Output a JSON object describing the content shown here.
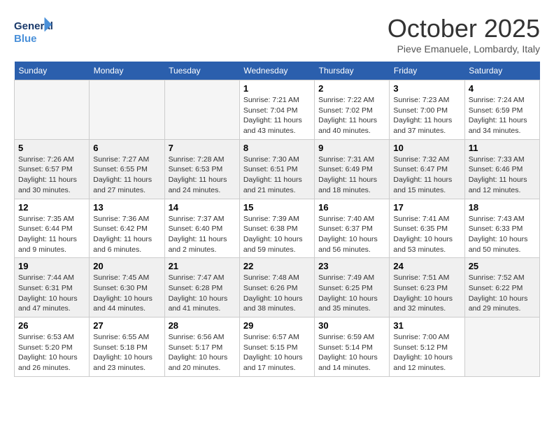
{
  "header": {
    "logo_line1": "General",
    "logo_line2": "Blue",
    "month": "October 2025",
    "location": "Pieve Emanuele, Lombardy, Italy"
  },
  "days_of_week": [
    "Sunday",
    "Monday",
    "Tuesday",
    "Wednesday",
    "Thursday",
    "Friday",
    "Saturday"
  ],
  "weeks": [
    [
      {
        "day": "",
        "info": ""
      },
      {
        "day": "",
        "info": ""
      },
      {
        "day": "",
        "info": ""
      },
      {
        "day": "1",
        "info": "Sunrise: 7:21 AM\nSunset: 7:04 PM\nDaylight: 11 hours\nand 43 minutes."
      },
      {
        "day": "2",
        "info": "Sunrise: 7:22 AM\nSunset: 7:02 PM\nDaylight: 11 hours\nand 40 minutes."
      },
      {
        "day": "3",
        "info": "Sunrise: 7:23 AM\nSunset: 7:00 PM\nDaylight: 11 hours\nand 37 minutes."
      },
      {
        "day": "4",
        "info": "Sunrise: 7:24 AM\nSunset: 6:59 PM\nDaylight: 11 hours\nand 34 minutes."
      }
    ],
    [
      {
        "day": "5",
        "info": "Sunrise: 7:26 AM\nSunset: 6:57 PM\nDaylight: 11 hours\nand 30 minutes."
      },
      {
        "day": "6",
        "info": "Sunrise: 7:27 AM\nSunset: 6:55 PM\nDaylight: 11 hours\nand 27 minutes."
      },
      {
        "day": "7",
        "info": "Sunrise: 7:28 AM\nSunset: 6:53 PM\nDaylight: 11 hours\nand 24 minutes."
      },
      {
        "day": "8",
        "info": "Sunrise: 7:30 AM\nSunset: 6:51 PM\nDaylight: 11 hours\nand 21 minutes."
      },
      {
        "day": "9",
        "info": "Sunrise: 7:31 AM\nSunset: 6:49 PM\nDaylight: 11 hours\nand 18 minutes."
      },
      {
        "day": "10",
        "info": "Sunrise: 7:32 AM\nSunset: 6:47 PM\nDaylight: 11 hours\nand 15 minutes."
      },
      {
        "day": "11",
        "info": "Sunrise: 7:33 AM\nSunset: 6:46 PM\nDaylight: 11 hours\nand 12 minutes."
      }
    ],
    [
      {
        "day": "12",
        "info": "Sunrise: 7:35 AM\nSunset: 6:44 PM\nDaylight: 11 hours\nand 9 minutes."
      },
      {
        "day": "13",
        "info": "Sunrise: 7:36 AM\nSunset: 6:42 PM\nDaylight: 11 hours\nand 6 minutes."
      },
      {
        "day": "14",
        "info": "Sunrise: 7:37 AM\nSunset: 6:40 PM\nDaylight: 11 hours\nand 2 minutes."
      },
      {
        "day": "15",
        "info": "Sunrise: 7:39 AM\nSunset: 6:38 PM\nDaylight: 10 hours\nand 59 minutes."
      },
      {
        "day": "16",
        "info": "Sunrise: 7:40 AM\nSunset: 6:37 PM\nDaylight: 10 hours\nand 56 minutes."
      },
      {
        "day": "17",
        "info": "Sunrise: 7:41 AM\nSunset: 6:35 PM\nDaylight: 10 hours\nand 53 minutes."
      },
      {
        "day": "18",
        "info": "Sunrise: 7:43 AM\nSunset: 6:33 PM\nDaylight: 10 hours\nand 50 minutes."
      }
    ],
    [
      {
        "day": "19",
        "info": "Sunrise: 7:44 AM\nSunset: 6:31 PM\nDaylight: 10 hours\nand 47 minutes."
      },
      {
        "day": "20",
        "info": "Sunrise: 7:45 AM\nSunset: 6:30 PM\nDaylight: 10 hours\nand 44 minutes."
      },
      {
        "day": "21",
        "info": "Sunrise: 7:47 AM\nSunset: 6:28 PM\nDaylight: 10 hours\nand 41 minutes."
      },
      {
        "day": "22",
        "info": "Sunrise: 7:48 AM\nSunset: 6:26 PM\nDaylight: 10 hours\nand 38 minutes."
      },
      {
        "day": "23",
        "info": "Sunrise: 7:49 AM\nSunset: 6:25 PM\nDaylight: 10 hours\nand 35 minutes."
      },
      {
        "day": "24",
        "info": "Sunrise: 7:51 AM\nSunset: 6:23 PM\nDaylight: 10 hours\nand 32 minutes."
      },
      {
        "day": "25",
        "info": "Sunrise: 7:52 AM\nSunset: 6:22 PM\nDaylight: 10 hours\nand 29 minutes."
      }
    ],
    [
      {
        "day": "26",
        "info": "Sunrise: 6:53 AM\nSunset: 5:20 PM\nDaylight: 10 hours\nand 26 minutes."
      },
      {
        "day": "27",
        "info": "Sunrise: 6:55 AM\nSunset: 5:18 PM\nDaylight: 10 hours\nand 23 minutes."
      },
      {
        "day": "28",
        "info": "Sunrise: 6:56 AM\nSunset: 5:17 PM\nDaylight: 10 hours\nand 20 minutes."
      },
      {
        "day": "29",
        "info": "Sunrise: 6:57 AM\nSunset: 5:15 PM\nDaylight: 10 hours\nand 17 minutes."
      },
      {
        "day": "30",
        "info": "Sunrise: 6:59 AM\nSunset: 5:14 PM\nDaylight: 10 hours\nand 14 minutes."
      },
      {
        "day": "31",
        "info": "Sunrise: 7:00 AM\nSunset: 5:12 PM\nDaylight: 10 hours\nand 12 minutes."
      },
      {
        "day": "",
        "info": ""
      }
    ]
  ]
}
